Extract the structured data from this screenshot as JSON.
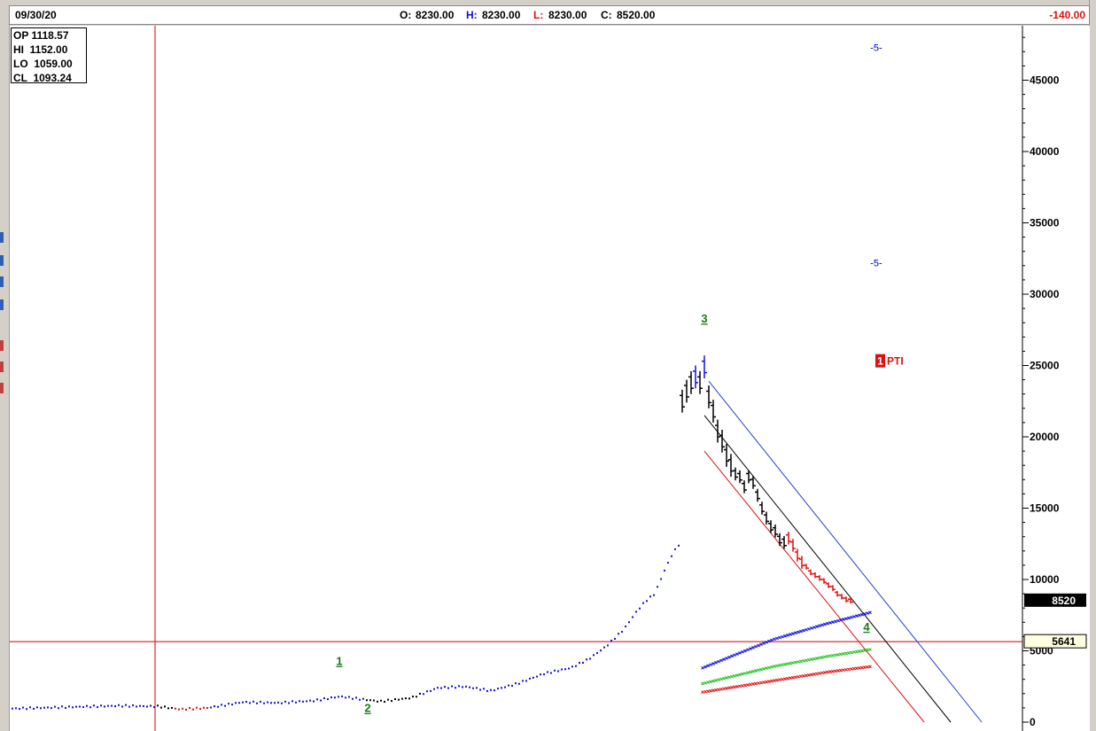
{
  "header": {
    "date": "09/30/20",
    "open_label": "O:",
    "open_value": "8230.00",
    "high_label": "H:",
    "high_value": "8230.00",
    "low_label": "L:",
    "low_value": "8230.00",
    "close_label": "C:",
    "close_value": "8520.00",
    "change": "-140.00"
  },
  "ohlc_box": {
    "op_label": "OP",
    "op_value": "1118.57",
    "hi_label": "HI",
    "hi_value": "1152.00",
    "lo_label": "LO",
    "lo_value": "1059.00",
    "cl_label": "CL",
    "cl_value": "1093.24"
  },
  "price_tags": {
    "last": "8520",
    "crosshair": "5641"
  },
  "colors": {
    "up": "#1010e0",
    "down": "#e01010",
    "neutral": "#000000",
    "wave_label": "#1a7a1a",
    "projection": "#0000cc",
    "pti_bg": "#e01010",
    "crosshair": "#cc0000",
    "green_band": "#20c020"
  },
  "chart_data": {
    "type": "line",
    "title": "",
    "xlabel": "",
    "ylabel": "",
    "ylim": [
      0,
      49000
    ],
    "yticks": [
      0,
      5000,
      10000,
      15000,
      20000,
      25000,
      30000,
      35000,
      40000,
      45000
    ],
    "ytick_labels": [
      "0",
      "5000",
      "10000",
      "15000",
      "20000",
      "25000",
      "30000",
      "35000",
      "40000",
      "45000"
    ],
    "grid": false,
    "last_price": 8520,
    "crosshair_price": 5641,
    "wave_labels": [
      {
        "label": "1",
        "index": 370,
        "value": 4000
      },
      {
        "label": "2",
        "index": 402,
        "value": 700
      },
      {
        "label": "3",
        "index": 782,
        "value": 28000
      },
      {
        "label": "4",
        "index": 965,
        "value": 6400
      }
    ],
    "projection_labels": [
      {
        "label": "-5-",
        "value": 47300
      },
      {
        "label": "-5-",
        "value": 32200
      }
    ],
    "pti_label": {
      "number": "1",
      "text": "PTI",
      "value": 25300
    },
    "series": [
      {
        "style": "dots",
        "points": [
          [
            0,
            950
          ],
          [
            60,
            1050
          ],
          [
            120,
            1150
          ],
          [
            165,
            1100
          ],
          [
            190,
            900
          ],
          [
            220,
            1000
          ],
          [
            260,
            1400
          ],
          [
            300,
            1350
          ],
          [
            340,
            1500
          ],
          [
            370,
            1800
          ],
          [
            395,
            1600
          ],
          [
            415,
            1450
          ],
          [
            450,
            1700
          ],
          [
            480,
            2400
          ],
          [
            510,
            2500
          ],
          [
            540,
            2200
          ],
          [
            570,
            2700
          ],
          [
            600,
            3400
          ],
          [
            630,
            3800
          ],
          [
            650,
            4400
          ],
          [
            670,
            5300
          ],
          [
            690,
            6500
          ],
          [
            705,
            7800
          ],
          [
            715,
            8500
          ],
          [
            725,
            9000
          ],
          [
            735,
            10500
          ],
          [
            745,
            11800
          ],
          [
            755,
            12700
          ]
        ]
      },
      {
        "style": "bars",
        "points": [
          [
            757,
            22500
          ],
          [
            762,
            23200
          ],
          [
            767,
            23800
          ],
          [
            772,
            24200
          ],
          [
            777,
            23800
          ],
          [
            782,
            24900
          ],
          [
            787,
            22800
          ],
          [
            792,
            21800
          ],
          [
            797,
            20400
          ],
          [
            802,
            19700
          ],
          [
            807,
            18700
          ],
          [
            812,
            18000
          ],
          [
            817,
            17400
          ],
          [
            822,
            17200
          ],
          [
            827,
            16500
          ],
          [
            832,
            17200
          ],
          [
            837,
            16800
          ],
          [
            842,
            15900
          ],
          [
            847,
            15000
          ],
          [
            852,
            14300
          ],
          [
            857,
            13700
          ],
          [
            862,
            13400
          ],
          [
            867,
            12800
          ],
          [
            872,
            12600
          ],
          [
            877,
            12900
          ],
          [
            882,
            12400
          ],
          [
            887,
            11700
          ],
          [
            892,
            11200
          ],
          [
            897,
            10900
          ],
          [
            902,
            10500
          ],
          [
            907,
            10300
          ],
          [
            912,
            10100
          ],
          [
            917,
            9900
          ],
          [
            922,
            9600
          ],
          [
            927,
            9400
          ],
          [
            932,
            9000
          ],
          [
            937,
            8800
          ],
          [
            942,
            8600
          ],
          [
            947,
            8520
          ]
        ]
      },
      {
        "style": "band",
        "name": "",
        "points": [
          [
            780,
            3800
          ],
          [
            860,
            5800
          ],
          [
            920,
            6900
          ],
          [
            970,
            7700
          ]
        ]
      },
      {
        "style": "band",
        "name": "",
        "points": [
          [
            780,
            2700
          ],
          [
            860,
            3900
          ],
          [
            920,
            4600
          ],
          [
            970,
            5100
          ]
        ]
      },
      {
        "style": "band",
        "name": "",
        "points": [
          [
            780,
            2100
          ],
          [
            860,
            2900
          ],
          [
            920,
            3500
          ],
          [
            970,
            3900
          ]
        ]
      }
    ],
    "channel_lines": [
      {
        "color": "blue",
        "from": [
          787,
          23900
        ],
        "to": [
          1095,
          0
        ]
      },
      {
        "color": "black",
        "from": [
          782,
          21500
        ],
        "to": [
          1060,
          0
        ]
      },
      {
        "color": "red",
        "from": [
          782,
          19000
        ],
        "to": [
          1030,
          0
        ]
      }
    ]
  }
}
